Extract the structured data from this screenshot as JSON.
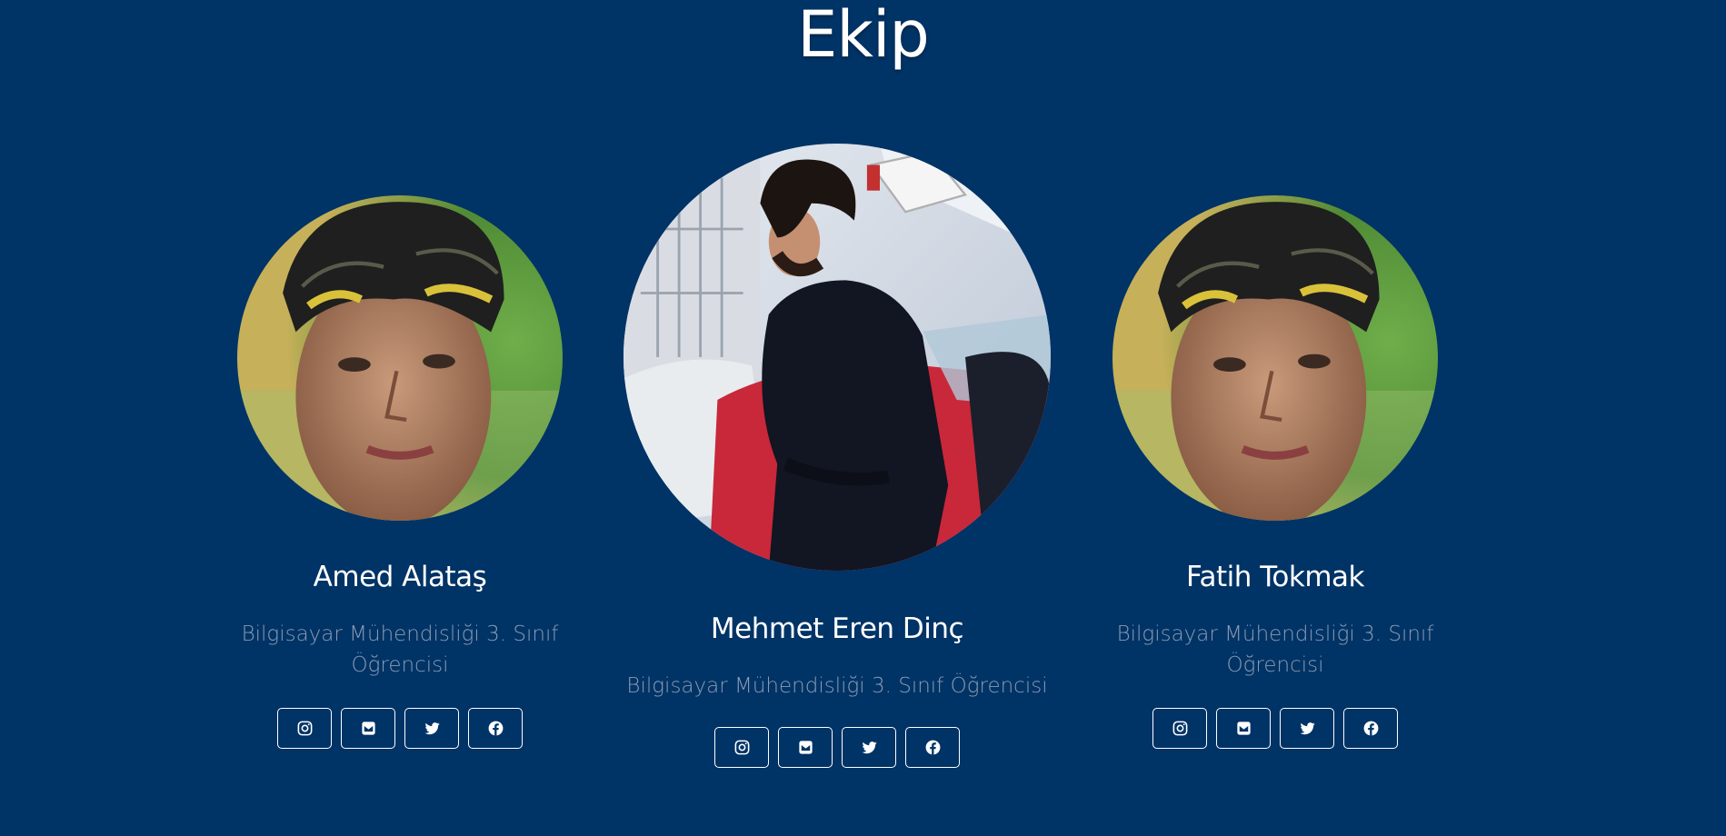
{
  "section": {
    "title": "Ekip"
  },
  "members": [
    {
      "name": "Amed Alataş",
      "role": "Bilgisayar Mühendisliği 3. Sınıf Öğrencisi",
      "photo": "man-with-headscarf-photo",
      "socials": [
        "instagram-icon",
        "mail-icon",
        "twitter-icon",
        "facebook-icon"
      ]
    },
    {
      "name": "Mehmet Eren Dinç",
      "role": "Bilgisayar Mühendisliği 3. Sınıf Öğrencisi",
      "photo": "man-black-sweater-photo",
      "socials": [
        "instagram-icon",
        "mail-icon",
        "twitter-icon",
        "facebook-icon"
      ]
    },
    {
      "name": "Fatih Tokmak",
      "role": "Bilgisayar Mühendisliği 3. Sınıf Öğrencisi",
      "photo": "man-with-headscarf-photo",
      "socials": [
        "instagram-icon",
        "mail-icon",
        "twitter-icon",
        "facebook-icon"
      ]
    }
  ],
  "colors": {
    "background": "#003366",
    "text": "#ffffff",
    "role_text": "#8a9bb3"
  }
}
